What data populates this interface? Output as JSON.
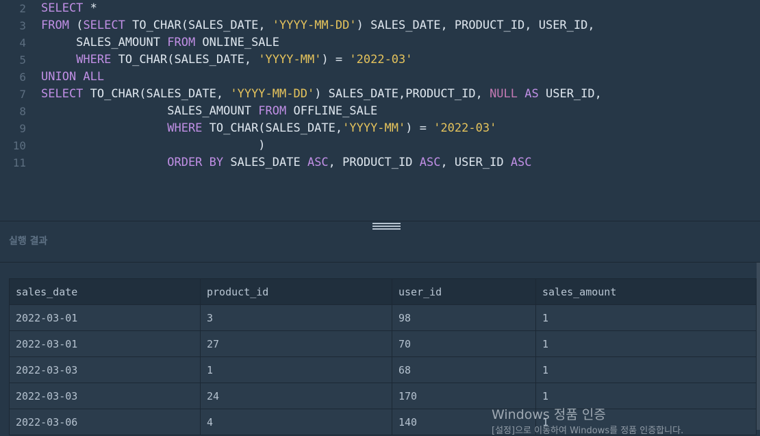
{
  "editor": {
    "lines": [
      {
        "num": "2",
        "tokens": [
          {
            "t": "kw",
            "v": "SELECT"
          },
          {
            "t": "pl",
            "v": " *"
          }
        ]
      },
      {
        "num": "3",
        "tokens": [
          {
            "t": "kw",
            "v": "FROM"
          },
          {
            "t": "pl",
            "v": " ("
          },
          {
            "t": "kw",
            "v": "SELECT"
          },
          {
            "t": "pl",
            "v": " TO_CHAR(SALES_DATE, "
          },
          {
            "t": "str",
            "v": "'YYYY-MM-DD'"
          },
          {
            "t": "pl",
            "v": ") SALES_DATE, PRODUCT_ID, USER_ID,"
          }
        ]
      },
      {
        "num": "4",
        "tokens": [
          {
            "t": "pl",
            "v": "     SALES_AMOUNT "
          },
          {
            "t": "kw",
            "v": "FROM"
          },
          {
            "t": "pl",
            "v": " ONLINE_SALE"
          }
        ]
      },
      {
        "num": "5",
        "tokens": [
          {
            "t": "pl",
            "v": "     "
          },
          {
            "t": "kw",
            "v": "WHERE"
          },
          {
            "t": "pl",
            "v": " TO_CHAR(SALES_DATE, "
          },
          {
            "t": "str",
            "v": "'YYYY-MM'"
          },
          {
            "t": "pl",
            "v": ") = "
          },
          {
            "t": "str",
            "v": "'2022-03'"
          }
        ]
      },
      {
        "num": "6",
        "tokens": [
          {
            "t": "kw",
            "v": "UNION ALL"
          }
        ]
      },
      {
        "num": "7",
        "tokens": [
          {
            "t": "kw",
            "v": "SELECT"
          },
          {
            "t": "pl",
            "v": " TO_CHAR(SALES_DATE, "
          },
          {
            "t": "str",
            "v": "'YYYY-MM-DD'"
          },
          {
            "t": "pl",
            "v": ") SALES_DATE,PRODUCT_ID, "
          },
          {
            "t": "nul",
            "v": "NULL"
          },
          {
            "t": "pl",
            "v": " "
          },
          {
            "t": "kw",
            "v": "AS"
          },
          {
            "t": "pl",
            "v": " USER_ID,"
          }
        ]
      },
      {
        "num": "8",
        "tokens": [
          {
            "t": "pl",
            "v": "                  SALES_AMOUNT "
          },
          {
            "t": "kw",
            "v": "FROM"
          },
          {
            "t": "pl",
            "v": " OFFLINE_SALE"
          }
        ]
      },
      {
        "num": "9",
        "tokens": [
          {
            "t": "pl",
            "v": "                  "
          },
          {
            "t": "kw",
            "v": "WHERE"
          },
          {
            "t": "pl",
            "v": " TO_CHAR(SALES_DATE,"
          },
          {
            "t": "str",
            "v": "'YYYY-MM'"
          },
          {
            "t": "pl",
            "v": ") = "
          },
          {
            "t": "str",
            "v": "'2022-03'"
          }
        ]
      },
      {
        "num": "10",
        "tokens": [
          {
            "t": "pl",
            "v": "                               )"
          }
        ]
      },
      {
        "num": "11",
        "tokens": [
          {
            "t": "pl",
            "v": "                  "
          },
          {
            "t": "kw",
            "v": "ORDER BY"
          },
          {
            "t": "pl",
            "v": " SALES_DATE "
          },
          {
            "t": "kw",
            "v": "ASC"
          },
          {
            "t": "pl",
            "v": ", PRODUCT_ID "
          },
          {
            "t": "kw",
            "v": "ASC"
          },
          {
            "t": "pl",
            "v": ", USER_ID "
          },
          {
            "t": "kw",
            "v": "ASC"
          }
        ]
      }
    ]
  },
  "result": {
    "title": "실행 결과",
    "columns": [
      "sales_date",
      "product_id",
      "user_id",
      "sales_amount"
    ],
    "rows": [
      [
        "2022-03-01",
        "3",
        "98",
        "1"
      ],
      [
        "2022-03-01",
        "27",
        "70",
        "1"
      ],
      [
        "2022-03-03",
        "1",
        "68",
        "1"
      ],
      [
        "2022-03-03",
        "24",
        "170",
        "1"
      ],
      [
        "2022-03-06",
        "4",
        "140",
        "1"
      ]
    ]
  },
  "watermark": {
    "title": "Windows 정품 인증",
    "subtitle": "[설정]으로 이동하여 Windows를 정품 인증합니다."
  },
  "colors": {
    "background": "#263747",
    "keyword": "#c08fe5",
    "string": "#e5c35c",
    "null": "#c47ab4"
  }
}
